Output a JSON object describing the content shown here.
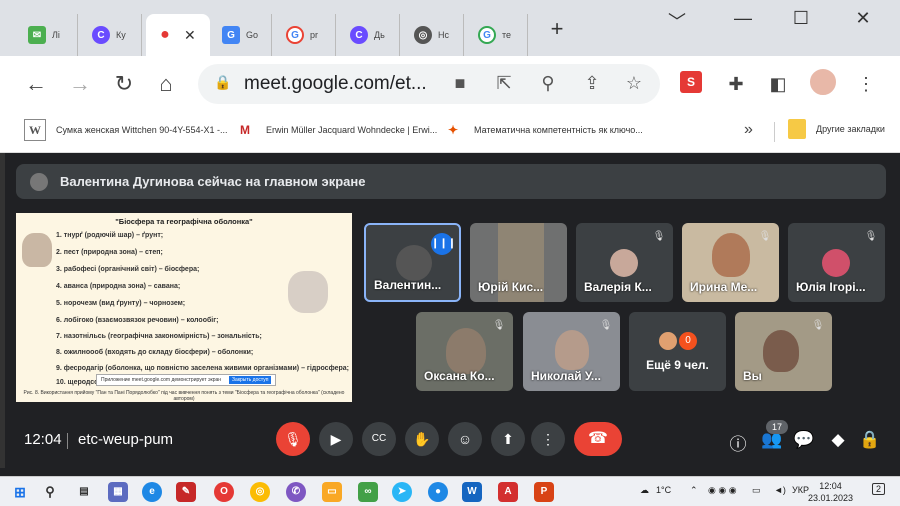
{
  "tabs": [
    {
      "label": "Лі",
      "color": "#4caf50",
      "glyph": "✉"
    },
    {
      "label": "Ку",
      "color": "#6a4cff",
      "glyph": "C"
    },
    {
      "label": "",
      "color": "#e53935",
      "glyph": "●"
    },
    {
      "label": "Go",
      "color": "#4285f4",
      "glyph": "G"
    },
    {
      "label": "pr",
      "color": "#4285f4",
      "glyph": "G"
    },
    {
      "label": "Дь",
      "color": "#6a4cff",
      "glyph": "C"
    },
    {
      "label": "Нс",
      "color": "#555",
      "glyph": "◎"
    },
    {
      "label": "те",
      "color": "#4285f4",
      "glyph": "G"
    }
  ],
  "window": {
    "min": "﹀",
    "minimize": "—",
    "maximize": "☐",
    "close": "✕",
    "newtab": "+",
    "tabclose": "✕"
  },
  "nav": {
    "back": "←",
    "forward": "→",
    "reload": "↻",
    "home": "⌂"
  },
  "address": {
    "url": "meet.google.com/et..."
  },
  "bookmarks": [
    {
      "label": "Сумка женская Wittchen 90-4Y-554-X1 -...",
      "icon": "W"
    },
    {
      "label": "Erwin Müller Jacquard Wohndecke | Erwi...",
      "icon": "M"
    },
    {
      "label": "Математична компетентність як ключо...",
      "icon": "✦"
    }
  ],
  "bookmarks_other": "Другие закладки",
  "bookmarks_more": "»",
  "banner": {
    "text": "Валентина Дугинова сейчас на главном экране"
  },
  "slide": {
    "title": "\"Біосфера та географічна оболонка\"",
    "lines": [
      "1. тнурґ (родючій шар) – ґрунт;",
      "2. пест (природна зона) – степ;",
      "3. рабофесі (органічний світ) – біосфера;",
      "4. аванса (природна зона) – савана;",
      "5. норочезм (вид ґрунту) – чорнозем;",
      "6. лобігоко (взаємозвязок речовин) – колообіг;",
      "7. назотнільсь (географічна закономірність) – зональність;",
      "8. ожилноооб (входять до складу біосфери) – оболонки;",
      "9. фесродагір (оболонка, що повністю заселена живими організмами) – гідросфера;",
      "10. щеродсоси (все, що оточує людину) – середовище."
    ],
    "caption": "Рис. 8. Використання прийому \"Пан та Пані Порядолюбко\" під час вивчення понять з теми \"Біосфера та географічна оболонка\" (складено автором)",
    "popup_text": "Приложение meet.google.com демонстрирует экран",
    "popup_button": "Закрыть доступ"
  },
  "participants": [
    {
      "name": "Валентин...",
      "bg": "#3c4043",
      "speaking": true
    },
    {
      "name": "Юрій Кис...",
      "bg": "#5a5a5a"
    },
    {
      "name": "Валерія К...",
      "bg": "#3c4043"
    },
    {
      "name": "Ирина Ме...",
      "bg": "#b8a890"
    },
    {
      "name": "Юлія Ігорі...",
      "bg": "#3c4043"
    },
    {
      "name": "Оксана Ко...",
      "bg": "#6b6e66"
    },
    {
      "name": "Николай У...",
      "bg": "#8a8d93"
    },
    {
      "name": "Ещё 9 чел.",
      "bg": "#3c4043",
      "count": "0"
    },
    {
      "name": "Вы",
      "bg": "#a39a86"
    }
  ],
  "meeting": {
    "time": "12:04",
    "code": "etc-weup-pum",
    "people_count": "17"
  },
  "taskbar": {
    "lang": "УКР",
    "temp": "1°C",
    "clock_time": "12:04",
    "clock_date": "23.01.2023",
    "notif": "2"
  }
}
